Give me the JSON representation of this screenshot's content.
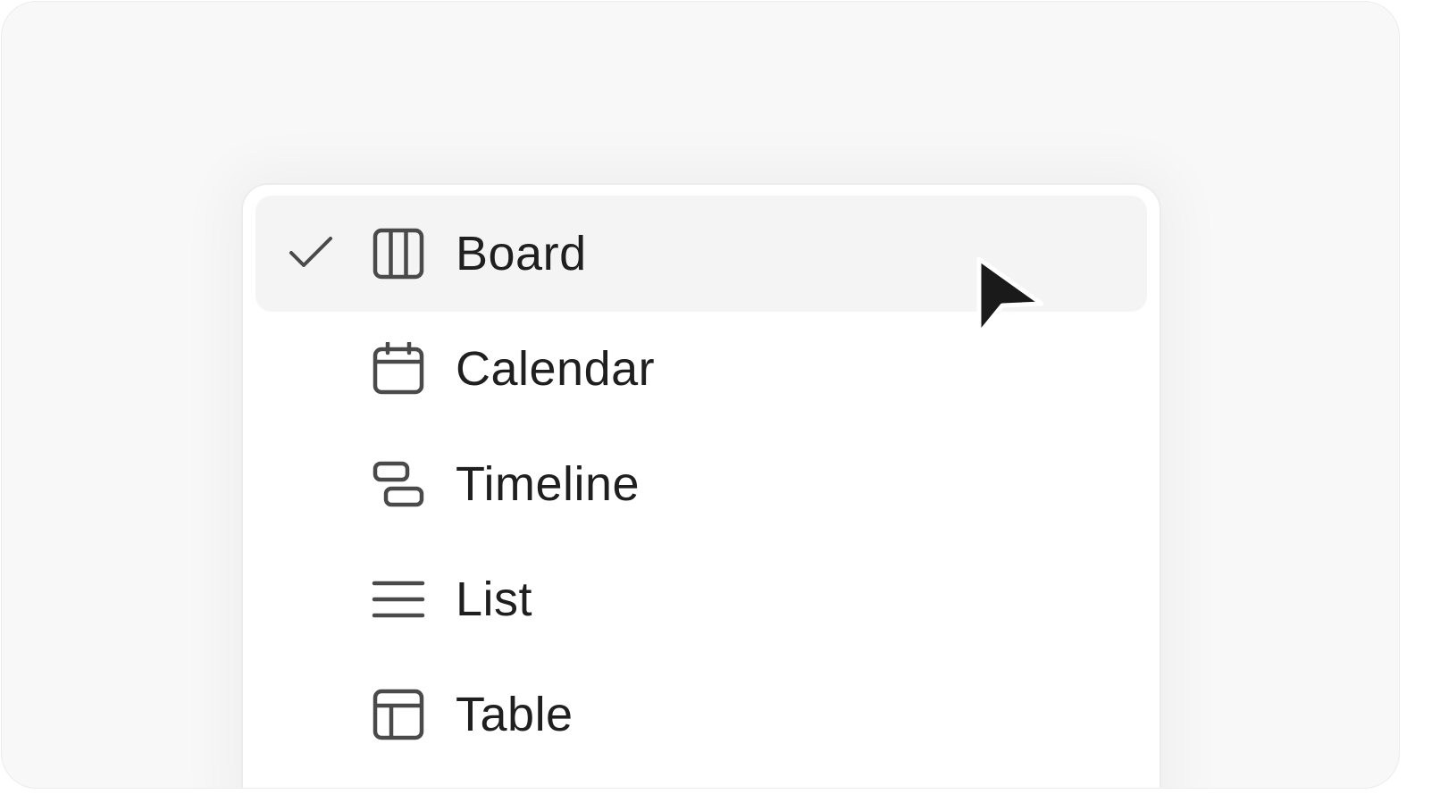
{
  "menu": {
    "items": [
      {
        "label": "Board",
        "icon": "board-icon",
        "selected": true
      },
      {
        "label": "Calendar",
        "icon": "calendar-icon",
        "selected": false
      },
      {
        "label": "Timeline",
        "icon": "timeline-icon",
        "selected": false
      },
      {
        "label": "List",
        "icon": "list-icon",
        "selected": false
      },
      {
        "label": "Table",
        "icon": "table-icon",
        "selected": false
      }
    ]
  },
  "colors": {
    "background": "#f8f8f8",
    "menu_background": "#ffffff",
    "selected_background": "#f4f4f4",
    "icon": "#4a4a4a",
    "text": "#1f1f1f",
    "cursor": "#1a1a1a"
  }
}
